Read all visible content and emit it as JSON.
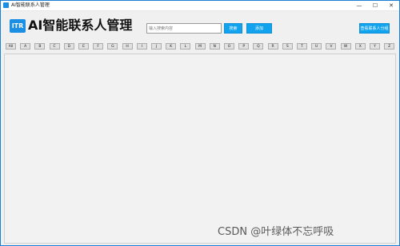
{
  "window": {
    "title": "AI智能联系人管理",
    "controls": {
      "minimize": "—",
      "maximize": "☐",
      "close": "✕"
    }
  },
  "header": {
    "logo_text": "ITR",
    "app_title": "AI智能联系人管理",
    "search_placeholder": "输入搜索内容",
    "search_label": "搜索",
    "add_label": "添加",
    "group_label": "查看联系人分组"
  },
  "letters": [
    "All",
    "A",
    "B",
    "C",
    "D",
    "E",
    "F",
    "G",
    "H",
    "I",
    "J",
    "K",
    "L",
    "M",
    "N",
    "O",
    "P",
    "Q",
    "R",
    "S",
    "T",
    "U",
    "V",
    "W",
    "X",
    "Y",
    "Z"
  ],
  "watermark": "CSDN @叶绿体不忘呼吸",
  "colors": {
    "accent": "#12a3ee",
    "logo": "#1a8fe3",
    "panel": "#f2f2f2"
  }
}
